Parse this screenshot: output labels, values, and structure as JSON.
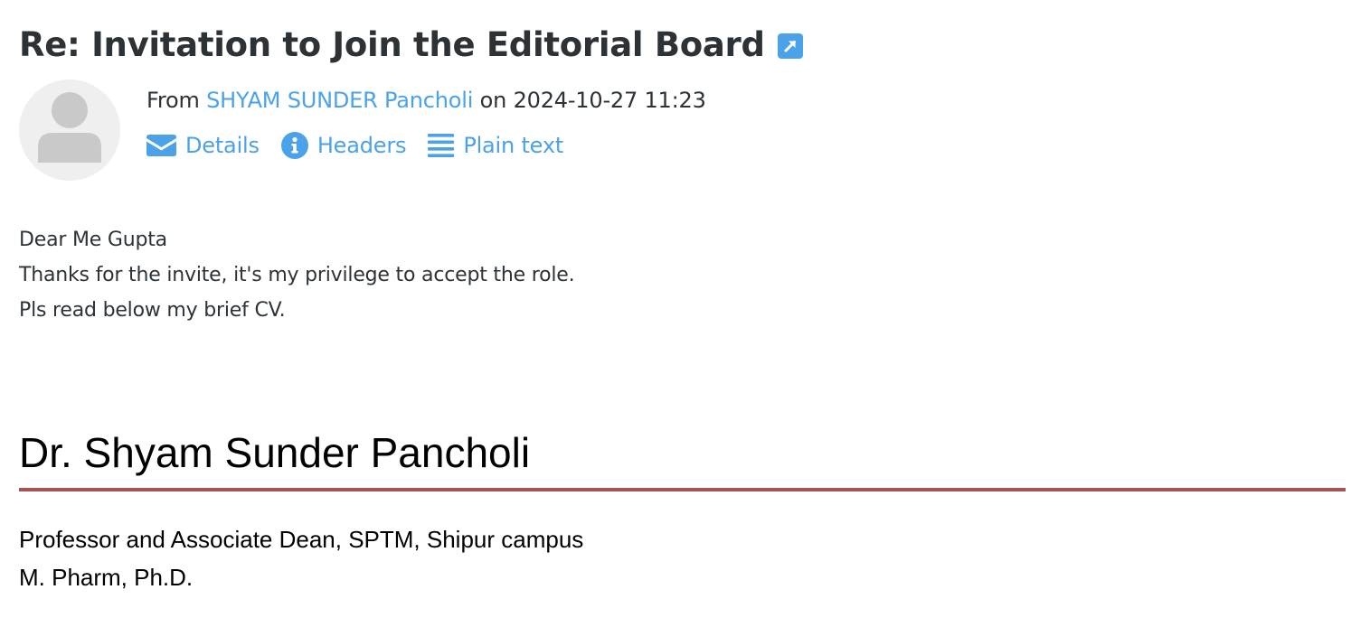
{
  "message": {
    "subject": "Re: Invitation to Join the Editorial Board",
    "from_prefix": "From",
    "sender_name": "SHYAM SUNDER Pancholi",
    "date_prefix": "on",
    "date": "2024-10-27 11:23"
  },
  "actions": {
    "details_label": "Details",
    "headers_label": "Headers",
    "plain_text_label": "Plain text"
  },
  "body": {
    "lines": [
      "Dear Me Gupta",
      "Thanks for the invite, it's my privilege to accept the role.",
      "Pls read below my brief CV."
    ]
  },
  "cv": {
    "name": "Dr. Shyam Sunder Pancholi",
    "lines": [
      "Professor and Associate Dean, SPTM, Shipur campus",
      "M. Pharm, Ph.D."
    ],
    "rule_color": "#a85256"
  },
  "theme": {
    "accent": "#4ba2e8",
    "text": "#2c3338"
  },
  "icons": {
    "open_external": "external-link-icon",
    "details": "envelope-icon",
    "headers": "info-icon",
    "plain_text": "lines-icon",
    "avatar": "user-silhouette-icon"
  }
}
